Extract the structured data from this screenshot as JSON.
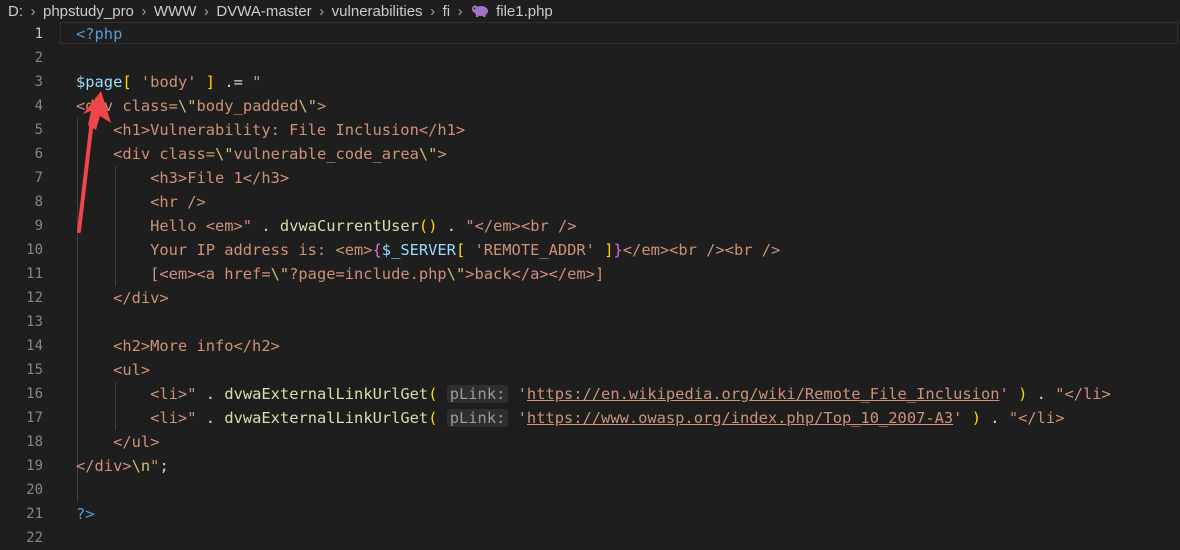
{
  "breadcrumb": {
    "drive": "D:",
    "folders": [
      "phpstudy_pro",
      "WWW",
      "DVWA-master",
      "vulnerabilities",
      "fi"
    ],
    "file": "file1.php",
    "separator_icon": "chevron-right-icon",
    "file_icon": "php-file-icon"
  },
  "editor": {
    "active_line": "1",
    "lines": [
      {
        "n": "1",
        "code": "<?php"
      },
      {
        "n": "2",
        "code": ""
      },
      {
        "n": "3",
        "code": "$page[ 'body' ] .= \""
      },
      {
        "n": "4",
        "code": "<div class=\\\"body_padded\\\">"
      },
      {
        "n": "5",
        "code": "    <h1>Vulnerability: File Inclusion</h1>"
      },
      {
        "n": "6",
        "code": "    <div class=\\\"vulnerable_code_area\\\">"
      },
      {
        "n": "7",
        "code": "        <h3>File 1</h3>"
      },
      {
        "n": "8",
        "code": "        <hr />"
      },
      {
        "n": "9",
        "code": "        Hello <em>\" . dvwaCurrentUser() . \"</em><br />"
      },
      {
        "n": "10",
        "code": "        Your IP address is: <em>{$_SERVER[ 'REMOTE_ADDR' ]}</em><br /><br />"
      },
      {
        "n": "11",
        "code": "        [<em><a href=\\\"?page=include.php\\\">back</a></em>]"
      },
      {
        "n": "12",
        "code": "    </div>"
      },
      {
        "n": "13",
        "code": ""
      },
      {
        "n": "14",
        "code": "    <h2>More info</h2>"
      },
      {
        "n": "15",
        "code": "    <ul>"
      },
      {
        "n": "16",
        "code": "        <li>\" . dvwaExternalLinkUrlGet( pLink: 'https://en.wikipedia.org/wiki/Remote_File_Inclusion' ) . \"</li>"
      },
      {
        "n": "17",
        "code": "        <li>\" . dvwaExternalLinkUrlGet( pLink: 'https://www.owasp.org/index.php/Top_10_2007-A3' ) . \"</li>"
      },
      {
        "n": "18",
        "code": "    </ul>"
      },
      {
        "n": "19",
        "code": "</div>\\n\";"
      },
      {
        "n": "20",
        "code": ""
      },
      {
        "n": "21",
        "code": "?>"
      },
      {
        "n": "22",
        "code": ""
      }
    ]
  },
  "colors": {
    "background": "#1e1e1e",
    "keyword": "#569cd6",
    "variable": "#9cdcfe",
    "string": "#ce9178",
    "function": "#dcdcaa",
    "bracket_gold": "#ffd700",
    "bracket_purple": "#da70d6",
    "annotation_arrow": "#f0454a"
  },
  "annotation": {
    "arrow_icon": "red-arrow-annotation"
  }
}
